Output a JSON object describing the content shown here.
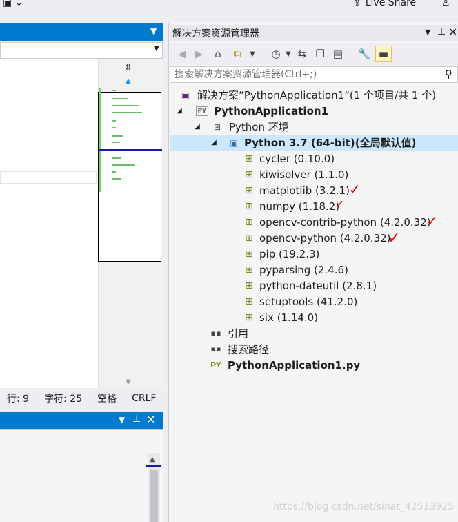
{
  "top": {
    "live_share": "Live Share"
  },
  "editor": {
    "status": {
      "line": "行: 9",
      "char": "字符: 25",
      "spaces": "空格",
      "eol": "CRLF"
    }
  },
  "solution_explorer": {
    "title": "解决方案资源管理器",
    "search_placeholder": "搜索解决方案资源管理器(Ctrl+;)",
    "solution": "解决方案“PythonApplication1”(1 个项目/共 1 个)",
    "project": "PythonApplication1",
    "python_env": "Python 环境",
    "interpreter": "Python 3.7 (64-bit)(全局默认值)",
    "packages": [
      "cycler (0.10.0)",
      "kiwisolver (1.1.0)",
      "matplotlib (3.2.1)",
      "numpy (1.18.2)",
      "opencv-contrib-python (4.2.0.32)",
      "opencv-python (4.2.0.32)",
      "pip (19.2.3)",
      "pyparsing (2.4.6)",
      "python-dateutil (2.8.1)",
      "setuptools (41.2.0)",
      "six (1.14.0)"
    ],
    "references": "引用",
    "search_paths": "搜索路径",
    "file": "PythonApplication1.py"
  },
  "watermark": "https://blog.csdn.net/sinat_42513925",
  "colors": {
    "accent": "#007acc",
    "selection": "#cce8ff",
    "check": "#e00000"
  }
}
